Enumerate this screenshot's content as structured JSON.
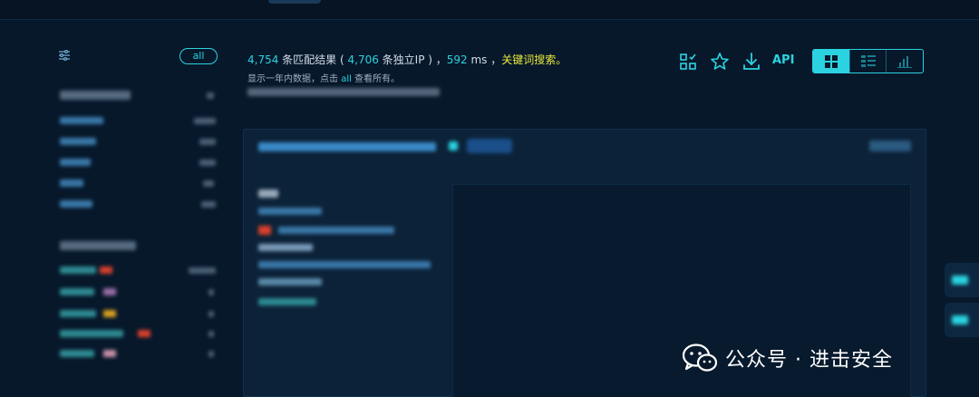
{
  "filter": {
    "all_label": "all"
  },
  "summary": {
    "match_count": "4,754",
    "match_label": " 条匹配结果 ( ",
    "ip_count": "4,706",
    "ip_label": " 条独立IP ) ，",
    "ms_value": "592",
    "ms_label": " ms ，",
    "search_type": "关键词搜索。"
  },
  "hint": {
    "prefix": "显示一年内数据，点击 ",
    "link": "all",
    "suffix": " 查看所有。"
  },
  "toolbar": {
    "api_label": "API"
  },
  "icons": [
    "filter-icon",
    "compare-icon",
    "star-icon",
    "download-icon",
    "grid-view-icon",
    "list-view-icon",
    "chart-view-icon",
    "wechat-icon"
  ],
  "watermark": {
    "text": "公众号 · 进击安全"
  },
  "colors": {
    "accent": "#2bd3e0",
    "highlight": "#e9e83c",
    "background": "#07182b"
  }
}
